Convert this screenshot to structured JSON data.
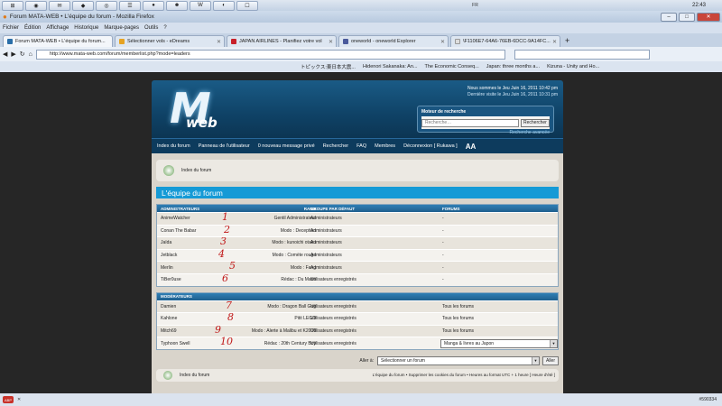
{
  "taskbar": {
    "clock": "22:43",
    "lang": "FR"
  },
  "window": {
    "title": "Forum MATA-WEB • L'équipe du forum - Mozilla Firefox"
  },
  "menu": [
    "Fichier",
    "Édition",
    "Affichage",
    "Historique",
    "Marque-pages",
    "Outils",
    "?"
  ],
  "tabs": [
    {
      "label": "Forum MATA-WEB • L'équipe du forum...",
      "color": "#2a6ea8"
    },
    {
      "label": "Sélectionner vols - eDreams",
      "color": "#e6a323"
    },
    {
      "label": "JAPAN AIRLINES - Planifiez votre vol",
      "color": "#c8202a"
    },
    {
      "label": "oneworld - oneworld Explorer",
      "color": "#4b5a9c"
    },
    {
      "label": "\\F1106E7-64A6-76EB-6DCC-9A14FC...",
      "color": "#dddddd"
    }
  ],
  "url": "http://www.mata-web.com/forum/memberlist.php?mode=leaders",
  "bookmarks": [
    "トピックス:東日本大震...",
    "Hidenori Sakanaka: An...",
    "The Economic Conseq...",
    "Japan: three months a...",
    "Kizuna - Unity and Ho..."
  ],
  "header": {
    "date_now": "Nous sommes le Jeu Juin 16, 2011 10:42 pm",
    "last_visit": "Dernière visite le Jeu Juin 16, 2011 10:31 pm",
    "search_label": "Moteur de recherche",
    "search_placeholder": "Recherche…",
    "search_button": "Rechercher",
    "advanced": "Recherche avancée",
    "logo_m": "M",
    "logo_web": "web"
  },
  "nav": [
    "Index du forum",
    "Panneau de l'utilisateur",
    "0 nouveau message privé",
    "Rechercher",
    "FAQ",
    "Membres",
    "Déconnexion [ Rukawa ]"
  ],
  "nav_aa": "AA",
  "breadcrumb": "Index du forum",
  "page_title": "L'équipe du forum",
  "admins": {
    "headers": [
      "ADMINISTRATEURS",
      "RANG",
      "GROUPE PAR DÉFAUT",
      "FORUMS"
    ],
    "rows": [
      {
        "name": "AnimeWatcher",
        "rank": "Gentil Administrateur",
        "group": "Administrateurs",
        "forums": "-",
        "mark": "1"
      },
      {
        "name": "Conan The Babar",
        "rank": "Modo : Deception",
        "group": "Administrateurs",
        "forums": "-",
        "mark": "2"
      },
      {
        "name": "Jaïda",
        "rank": "Modo : kunoichi otaku",
        "group": "Administrateurs",
        "forums": "-",
        "mark": "3"
      },
      {
        "name": "Jetblack",
        "rank": "Modo : Comète rouge",
        "group": "Administrateurs",
        "forums": "-",
        "mark": "4"
      },
      {
        "name": "Merlin",
        "rank": "Modo : Fang",
        "group": "Administrateurs",
        "forums": "-",
        "mark": "5"
      },
      {
        "name": "TiBer0use",
        "rank": "Rédac : Du Matin",
        "group": "Utilisateurs enregistrés",
        "forums": "-",
        "mark": "6"
      }
    ]
  },
  "mods": {
    "headers": [
      "MODÉRATEURS",
      "",
      "",
      ""
    ],
    "rows": [
      {
        "name": "Damien",
        "rank": "Modo : Dragon Ball Gag",
        "group": "Utilisateurs enregistrés",
        "forums": "Tous les forums",
        "mark": "7"
      },
      {
        "name": "Kahlone",
        "rank": "Pitit LEGO",
        "group": "Utilisateurs enregistrés",
        "forums": "Tous les forums",
        "mark": "8"
      },
      {
        "name": "Mitch69",
        "rank": "Modo : Alerte à Malibu et K2000",
        "group": "Utilisateurs enregistrés",
        "forums": "Tous les forums",
        "mark": "9"
      },
      {
        "name": "Typhoon Swell",
        "rank": "Rédac : 20th Century Boy",
        "group": "Utilisateurs enregistrés",
        "forums": "Manga & livres au Japon",
        "mark": "10"
      }
    ]
  },
  "jump": {
    "label": "Aller à:",
    "select": "Sélectionner un forum",
    "button": "Aller"
  },
  "footer": {
    "home": "Index du forum",
    "links": "L'équipe du forum • Supprimer les cookies du forum • Heures au format UTC + 1 heure [ Heure d'été ]"
  },
  "status": {
    "left": "ABP",
    "right": "#590334"
  }
}
